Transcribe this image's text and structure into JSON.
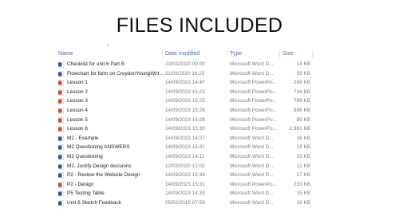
{
  "slide": {
    "title": "FILES INCLUDED"
  },
  "explorer": {
    "columns": {
      "name": "Name",
      "date": "Date modified",
      "type": "Type",
      "size": "Size"
    },
    "sort_indicator": "^",
    "files": [
      {
        "name": "Checklist for unit 6 Part B",
        "date": "23/03/2020 09:00",
        "type": "Microsoft Word D...",
        "size": "14 KB",
        "icon": "word-doc-icon",
        "color": "#2b5797"
      },
      {
        "name": "Flowchart for form on CroydonYoungWrit...",
        "date": "11/03/2020 16:25",
        "type": "Microsoft Word D...",
        "size": "59 KB",
        "icon": "word-doc-icon",
        "color": "#2b5797"
      },
      {
        "name": "Lesson 1",
        "date": "14/09/2023 14:47",
        "type": "Microsoft PowerPo...",
        "size": "288 KB",
        "icon": "powerpoint-icon",
        "color": "#d24726"
      },
      {
        "name": "Lesson 2",
        "date": "14/09/2023 15:23",
        "type": "Microsoft PowerPo...",
        "size": "734 KB",
        "icon": "powerpoint-icon",
        "color": "#d24726"
      },
      {
        "name": "Lesson 3",
        "date": "14/09/2023 15:25",
        "type": "Microsoft PowerPo...",
        "size": "786 KB",
        "icon": "powerpoint-icon",
        "color": "#d24726"
      },
      {
        "name": "Lesson 4",
        "date": "14/09/2023 15:26",
        "type": "Microsoft PowerPo...",
        "size": "806 KB",
        "icon": "powerpoint-icon",
        "color": "#d24726"
      },
      {
        "name": "Lesson 5",
        "date": "14/09/2023 15:28",
        "type": "Microsoft PowerPo...",
        "size": "85 KB",
        "icon": "powerpoint-icon",
        "color": "#d24726"
      },
      {
        "name": "Lesson 6",
        "date": "14/09/2023 15:30",
        "type": "Microsoft PowerPo...",
        "size": "1,961 KB",
        "icon": "powerpoint-icon",
        "color": "#d24726"
      },
      {
        "name": "M2 - Example",
        "date": "14/09/2023 14:07",
        "type": "Microsoft Word D...",
        "size": "16 KB",
        "icon": "word-doc-icon",
        "color": "#2b5797"
      },
      {
        "name": "M2 Questioning ANSWERS",
        "date": "14/09/2023 15:31",
        "type": "Microsoft Word D...",
        "size": "14 KB",
        "icon": "word-doc-icon",
        "color": "#2b5797"
      },
      {
        "name": "M2 Questioning",
        "date": "14/09/2023 14:11",
        "type": "Microsoft Word D...",
        "size": "15 KB",
        "icon": "word-doc-icon",
        "color": "#2b5797"
      },
      {
        "name": "M2. Justify Design decisions",
        "date": "12/03/2020 12:02",
        "type": "Microsoft Word D...",
        "size": "12 KB",
        "icon": "word-doc-icon",
        "color": "#2b5797"
      },
      {
        "name": "P2 -  Review the Website Design",
        "date": "14/09/2023 15:34",
        "type": "Microsoft Word D...",
        "size": "17 KB",
        "icon": "word-doc-icon",
        "color": "#2b5797"
      },
      {
        "name": "P2 - Design",
        "date": "14/09/2023 15:31",
        "type": "Microsoft PowerPo...",
        "size": "233 KB",
        "icon": "powerpoint-icon",
        "color": "#d24726"
      },
      {
        "name": "P5 Testing Table",
        "date": "14/09/2023 14:33",
        "type": "Microsoft Word D...",
        "size": "15 KB",
        "icon": "word-doc-icon",
        "color": "#2b5797"
      },
      {
        "name": "Unit 6 Sketch Feedback",
        "date": "05/02/2018 07:59",
        "type": "Microsoft Word D...",
        "size": "19 KB",
        "icon": "word-doc-icon",
        "color": "#2b5797"
      }
    ]
  }
}
